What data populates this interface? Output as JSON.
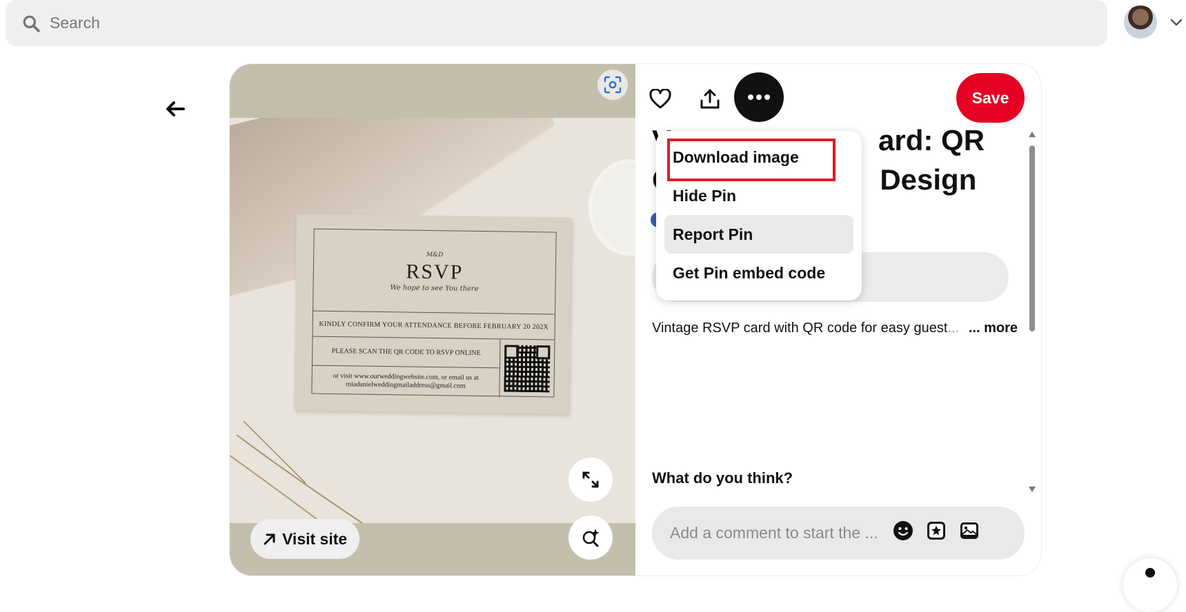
{
  "header": {
    "search_placeholder": "Search"
  },
  "pin": {
    "visit_site_label": "Visit site",
    "save_label": "Save",
    "title_visible": "V                    ard: QR\nC                    Design",
    "title_line1_right": "ard: QR",
    "title_line2_right": "Design",
    "description_visible": "Vintage RSVP card with QR code for easy guest",
    "description_fade": "...",
    "more_label": "... more",
    "comment_heading": "What do you think?",
    "comment_placeholder": "Add a comment to start the ..."
  },
  "card_image": {
    "monogram": "M&D",
    "title": "RSVP",
    "subtitle": "We hope to see You there",
    "row1": "KINDLY CONFIRM YOUR ATTENDANCE BEFORE FEBRUARY 20 202X",
    "row2": "PLEASE SCAN THE QR CODE TO RSVP ONLINE",
    "row3": "or visit www.ourweddingwebsite.com, or email us at miadanielweddingmailaddress@gmail.com"
  },
  "menu": {
    "items": [
      {
        "label": "Download image",
        "highlighted": true
      },
      {
        "label": "Hide Pin"
      },
      {
        "label": "Report Pin",
        "hovered": true
      },
      {
        "label": "Get Pin embed code"
      }
    ]
  },
  "colors": {
    "save": "#e60023",
    "highlight_box": "#e01b24",
    "media_bg": "#c4bead"
  },
  "icons": [
    "search-icon",
    "chevron-down-icon",
    "back-arrow-icon",
    "lens-icon",
    "expand-icon",
    "sparkle-search-icon",
    "arrow-up-right-icon",
    "heart-icon",
    "share-icon",
    "ellipsis-icon",
    "emoji-icon",
    "sticker-icon",
    "image-icon"
  ]
}
